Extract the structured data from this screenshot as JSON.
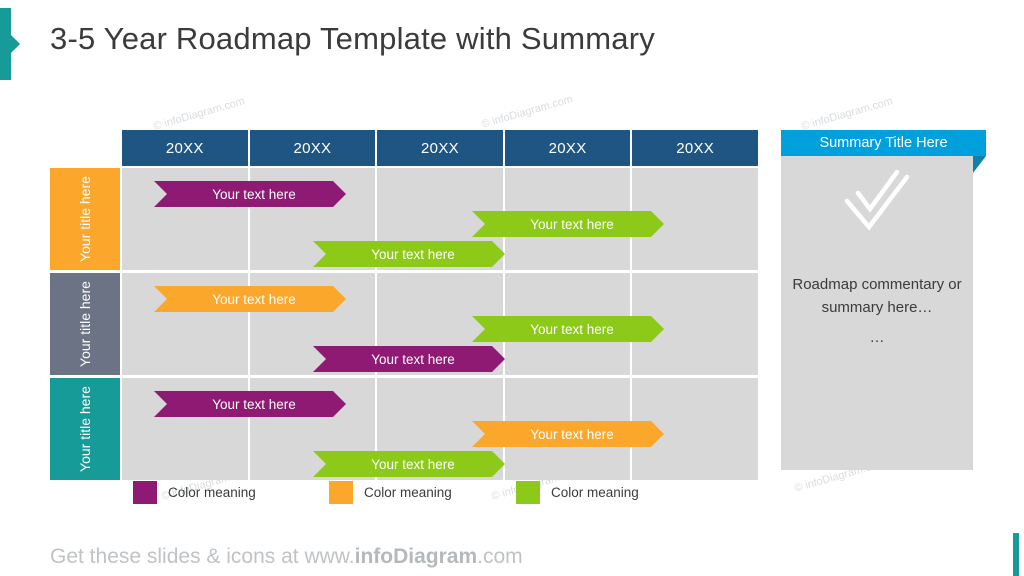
{
  "title": "3-5 Year Roadmap Template with Summary",
  "watermark_text": "© infoDiagram.com",
  "colors": {
    "purple": "#8e1a74",
    "orange": "#faa72c",
    "green": "#8dc919",
    "teal": "#179b98",
    "slate": "#6c7384",
    "header_blue": "#1f5582",
    "summary_blue": "#00a0dd",
    "summary_fold": "#1081ad",
    "band_gray": "#d8d8d8"
  },
  "timeline": {
    "year_headers": [
      "20XX",
      "20XX",
      "20XX",
      "20XX",
      "20XX"
    ],
    "rows": [
      {
        "label": "Your title here",
        "label_color": "#faa72c",
        "bars": [
          {
            "text": "Your text here",
            "color": "#8e1a74"
          },
          {
            "text": "Your text here",
            "color": "#8dc919"
          },
          {
            "text": "Your text here",
            "color": "#8dc919"
          }
        ]
      },
      {
        "label": "Your title here",
        "label_color": "#6c7384",
        "bars": [
          {
            "text": "Your text here",
            "color": "#faa72c"
          },
          {
            "text": "Your text here",
            "color": "#8dc919"
          },
          {
            "text": "Your text here",
            "color": "#8e1a74"
          }
        ]
      },
      {
        "label": "Your title here",
        "label_color": "#179b98",
        "bars": [
          {
            "text": "Your text here",
            "color": "#8e1a74"
          },
          {
            "text": "Your text here",
            "color": "#faa72c"
          },
          {
            "text": "Your text here",
            "color": "#8dc919"
          }
        ]
      }
    ]
  },
  "summary": {
    "title": "Summary Title Here",
    "icon": "checkmark-icon",
    "body": "Roadmap commentary or summary here…",
    "dots": "…"
  },
  "legend": [
    {
      "label": "Color meaning",
      "color": "#8e1a74"
    },
    {
      "label": "Color meaning",
      "color": "#faa72c"
    },
    {
      "label": "Color meaning",
      "color": "#8dc919"
    }
  ],
  "footer": {
    "prefix": "Get these slides & icons at www.",
    "brand": "infoDiagram",
    "suffix": ".com"
  }
}
